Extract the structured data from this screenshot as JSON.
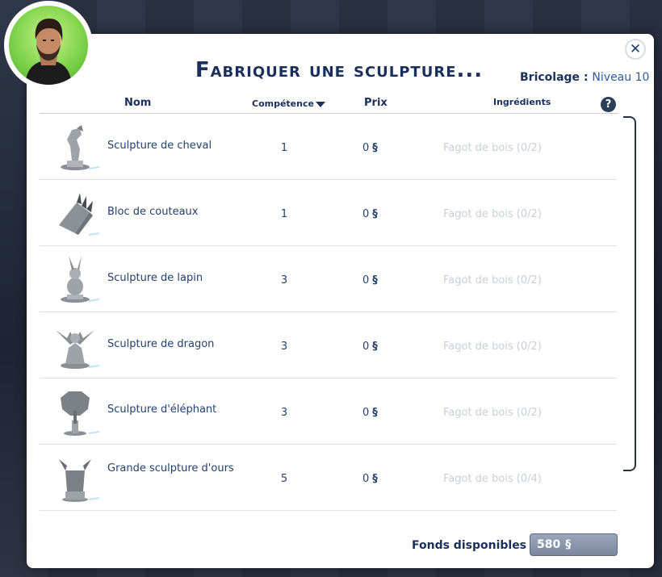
{
  "dialog": {
    "title": "Fabriquer une sculpture...",
    "skill_label": "Bricolage",
    "skill_separator": ":",
    "skill_level": "Niveau 10",
    "close_label": "✕",
    "help_label": "?"
  },
  "columns": {
    "name": "Nom",
    "skill": "Compétence",
    "price": "Prix",
    "ingredients": "Ingrédients"
  },
  "currency_symbol": "§",
  "items": [
    {
      "name": "Sculpture de cheval",
      "skill": "1",
      "price": "0",
      "ingredients": "Fagot de bois (0/2)",
      "icon": "horse-sculpture-icon"
    },
    {
      "name": "Bloc de couteaux",
      "skill": "1",
      "price": "0",
      "ingredients": "Fagot de bois (0/2)",
      "icon": "knife-block-icon"
    },
    {
      "name": "Sculpture de lapin",
      "skill": "3",
      "price": "0",
      "ingredients": "Fagot de bois (0/2)",
      "icon": "rabbit-sculpture-icon"
    },
    {
      "name": "Sculpture de dragon",
      "skill": "3",
      "price": "0",
      "ingredients": "Fagot de bois (0/2)",
      "icon": "dragon-sculpture-icon"
    },
    {
      "name": "Sculpture d'éléphant",
      "skill": "3",
      "price": "0",
      "ingredients": "Fagot de bois (0/2)",
      "icon": "elephant-sculpture-icon"
    },
    {
      "name": "Grande sculpture d'ours",
      "skill": "5",
      "price": "0",
      "ingredients": "Fagot de bois (0/4)",
      "icon": "bear-sculpture-icon"
    }
  ],
  "funds": {
    "label": "Fonds disponibles",
    "separator": ":",
    "value": "580"
  },
  "colors": {
    "title": "#1b2f5b",
    "accent": "#2a5caa",
    "avatar_bg": "#7fd34a",
    "disabled_text": "#c9ced8"
  }
}
